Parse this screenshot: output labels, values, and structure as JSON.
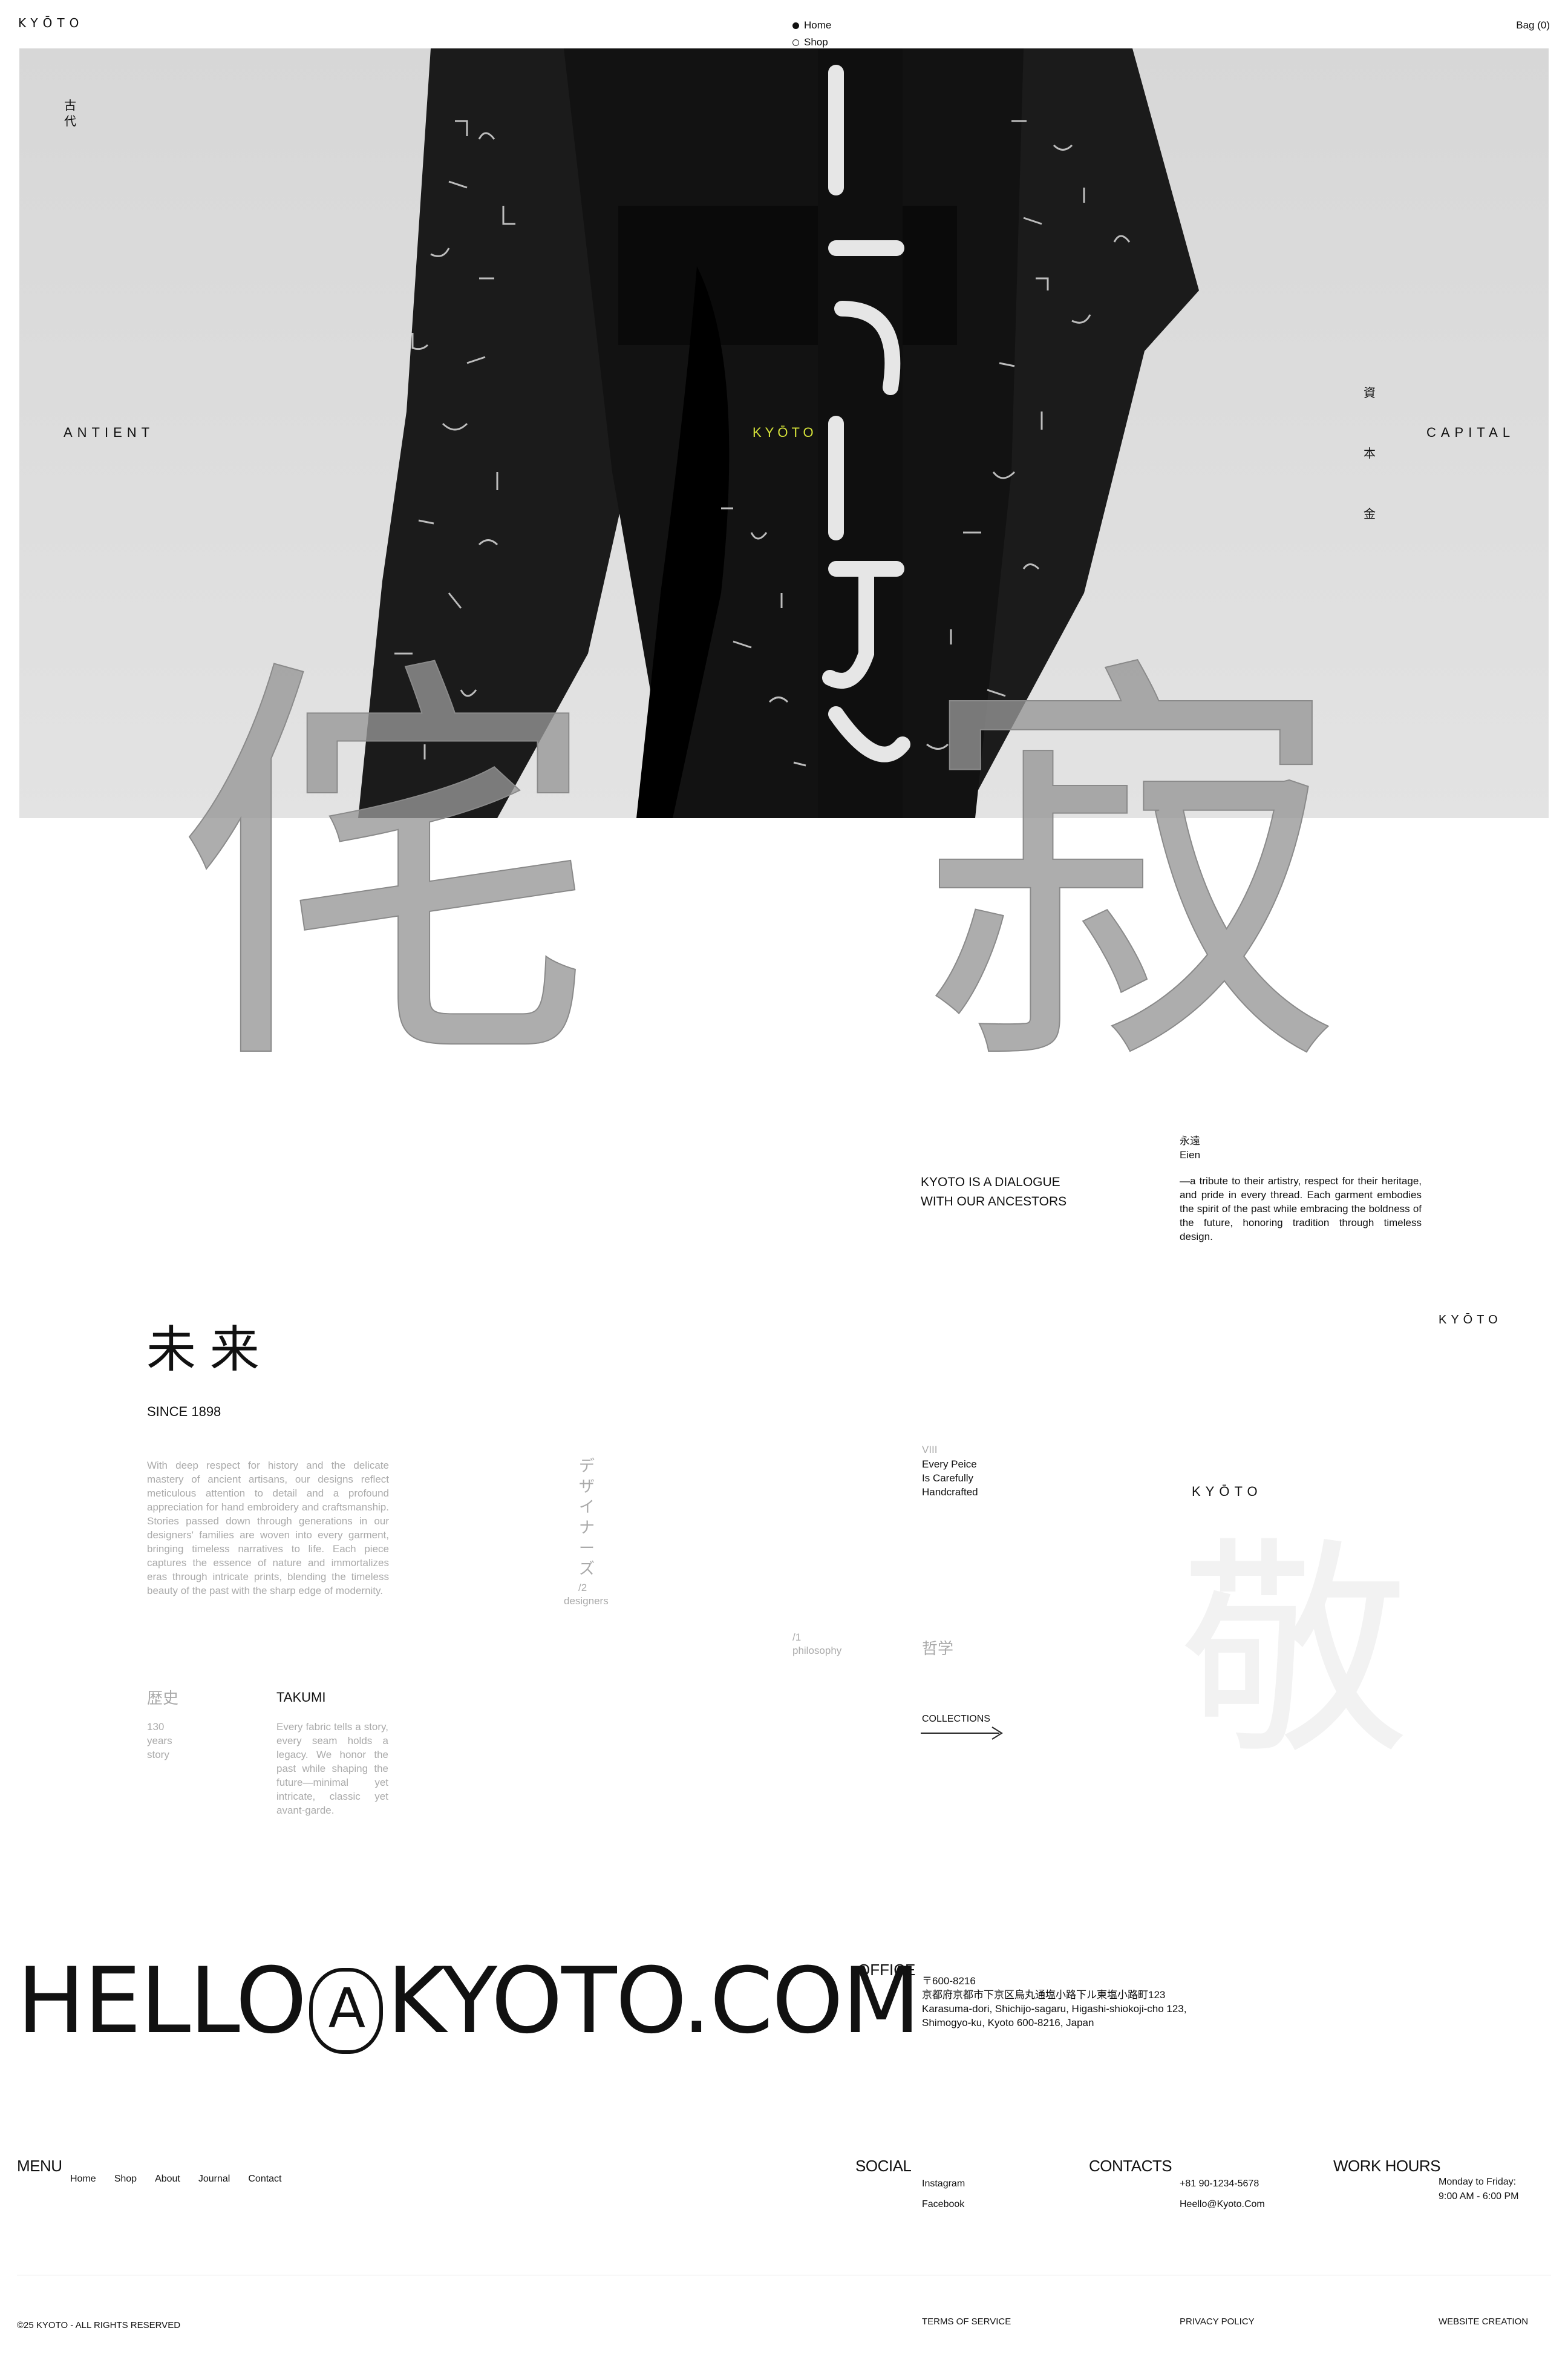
{
  "header": {
    "logo": "KYŌTO",
    "nav": [
      {
        "label": "Home",
        "active": true
      },
      {
        "label": "Shop",
        "active": false
      },
      {
        "label": "",
        "active": false
      },
      {
        "label": "",
        "active": false
      },
      {
        "label": "",
        "active": false
      }
    ],
    "bag": "Bag (0)"
  },
  "hero": {
    "kanji_top_left": [
      "古",
      "代"
    ],
    "left_word": "ANTIENT",
    "right_word": "CAPITAL",
    "kanji_right": [
      "資",
      "本",
      "金"
    ],
    "center_logo": "KYŌTO",
    "big_kanji": [
      "侘",
      "寂"
    ]
  },
  "intro": {
    "tagline_line1": "KYOTO IS A DIALOGUE",
    "tagline_line2": "WITH OUR ANCESTORS",
    "eien_kanji": "永遠",
    "eien_romaji": "Eien",
    "eien_text": "—a tribute to their artistry, respect for their heritage, and pride in every thread. Each garment embodies the spirit of the past while embracing the boldness of the future, honoring tradition through timeless design."
  },
  "story": {
    "right_logo": "KYŌTO",
    "mirai": "未 来",
    "since": "SINCE 1898",
    "body": "With deep respect for history and the delicate mastery of ancient artisans, our designs reflect meticulous attention to detail and a profound appreciation for hand embroidery and craftsmanship. Stories passed down through generations in our designers' families are woven into every garment, bringing timeless narratives to life. Each piece captures the essence of nature and immortalizes eras through intricate prints, blending the timeless beauty of the past with the sharp edge of modernity.",
    "designers_kana": [
      "デ",
      "ザ",
      "イ",
      "ナ",
      "ー",
      "ズ"
    ],
    "designers_num": "/2",
    "designers_label": "designers",
    "philosophy_num": "/1",
    "philosophy_label": "philosophy",
    "roman": "VIII",
    "handcrafted": [
      "Every Peice",
      "Is Carefully",
      "Handcrafted"
    ],
    "mid_logo": "KYŌTO",
    "tetsugaku": "哲学",
    "collections": "COLLECTIONS",
    "kei": "敬",
    "rekishi": "歴史",
    "years": [
      "130",
      "years",
      "story"
    ],
    "takumi": "TAKUMI",
    "takumi_text": "Every fabric tells a story, every seam holds a legacy. We honor the past while shaping the future—minimal yet intricate, classic yet avant-garde."
  },
  "contact": {
    "email_before": "HELLO",
    "email_at": "A",
    "email_after": "KYOTO.COM",
    "office_label": "OFFICE",
    "office_lines": [
      "〒600-8216",
      "京都府京都市下京区烏丸通塩小路下ル東塩小路町123",
      "Karasuma-dori, Shichijo-sagaru, Higashi-shiokoji-cho 123,",
      "Shimogyo-ku, Kyoto 600-8216, Japan"
    ]
  },
  "footer": {
    "menu_label": "MENU",
    "menu": [
      "Home",
      "Shop",
      "About",
      "Journal",
      "Contact"
    ],
    "social_label": "SOCIAL",
    "social": [
      "Instagram",
      "Facebook"
    ],
    "contacts_label": "CONTACTS",
    "phone": "+81 90-1234-5678",
    "email": "Heello@Kyoto.Com",
    "hours_label": "WORK HOURS",
    "hours": [
      "Monday to Friday:",
      "9:00 AM - 6:00 PM"
    ],
    "copyright": "©25 KYOTO - ALL RIGHTS RESERVED",
    "terms": "TERMS OF SERVICE",
    "privacy": "PRIVACY POLICY",
    "credit": "WEBSITE CREATION"
  },
  "colors": {
    "accent": "#d6e33a",
    "text": "#111111",
    "muted": "#aaaaaa",
    "hero_bg": "#dcdcdc"
  }
}
